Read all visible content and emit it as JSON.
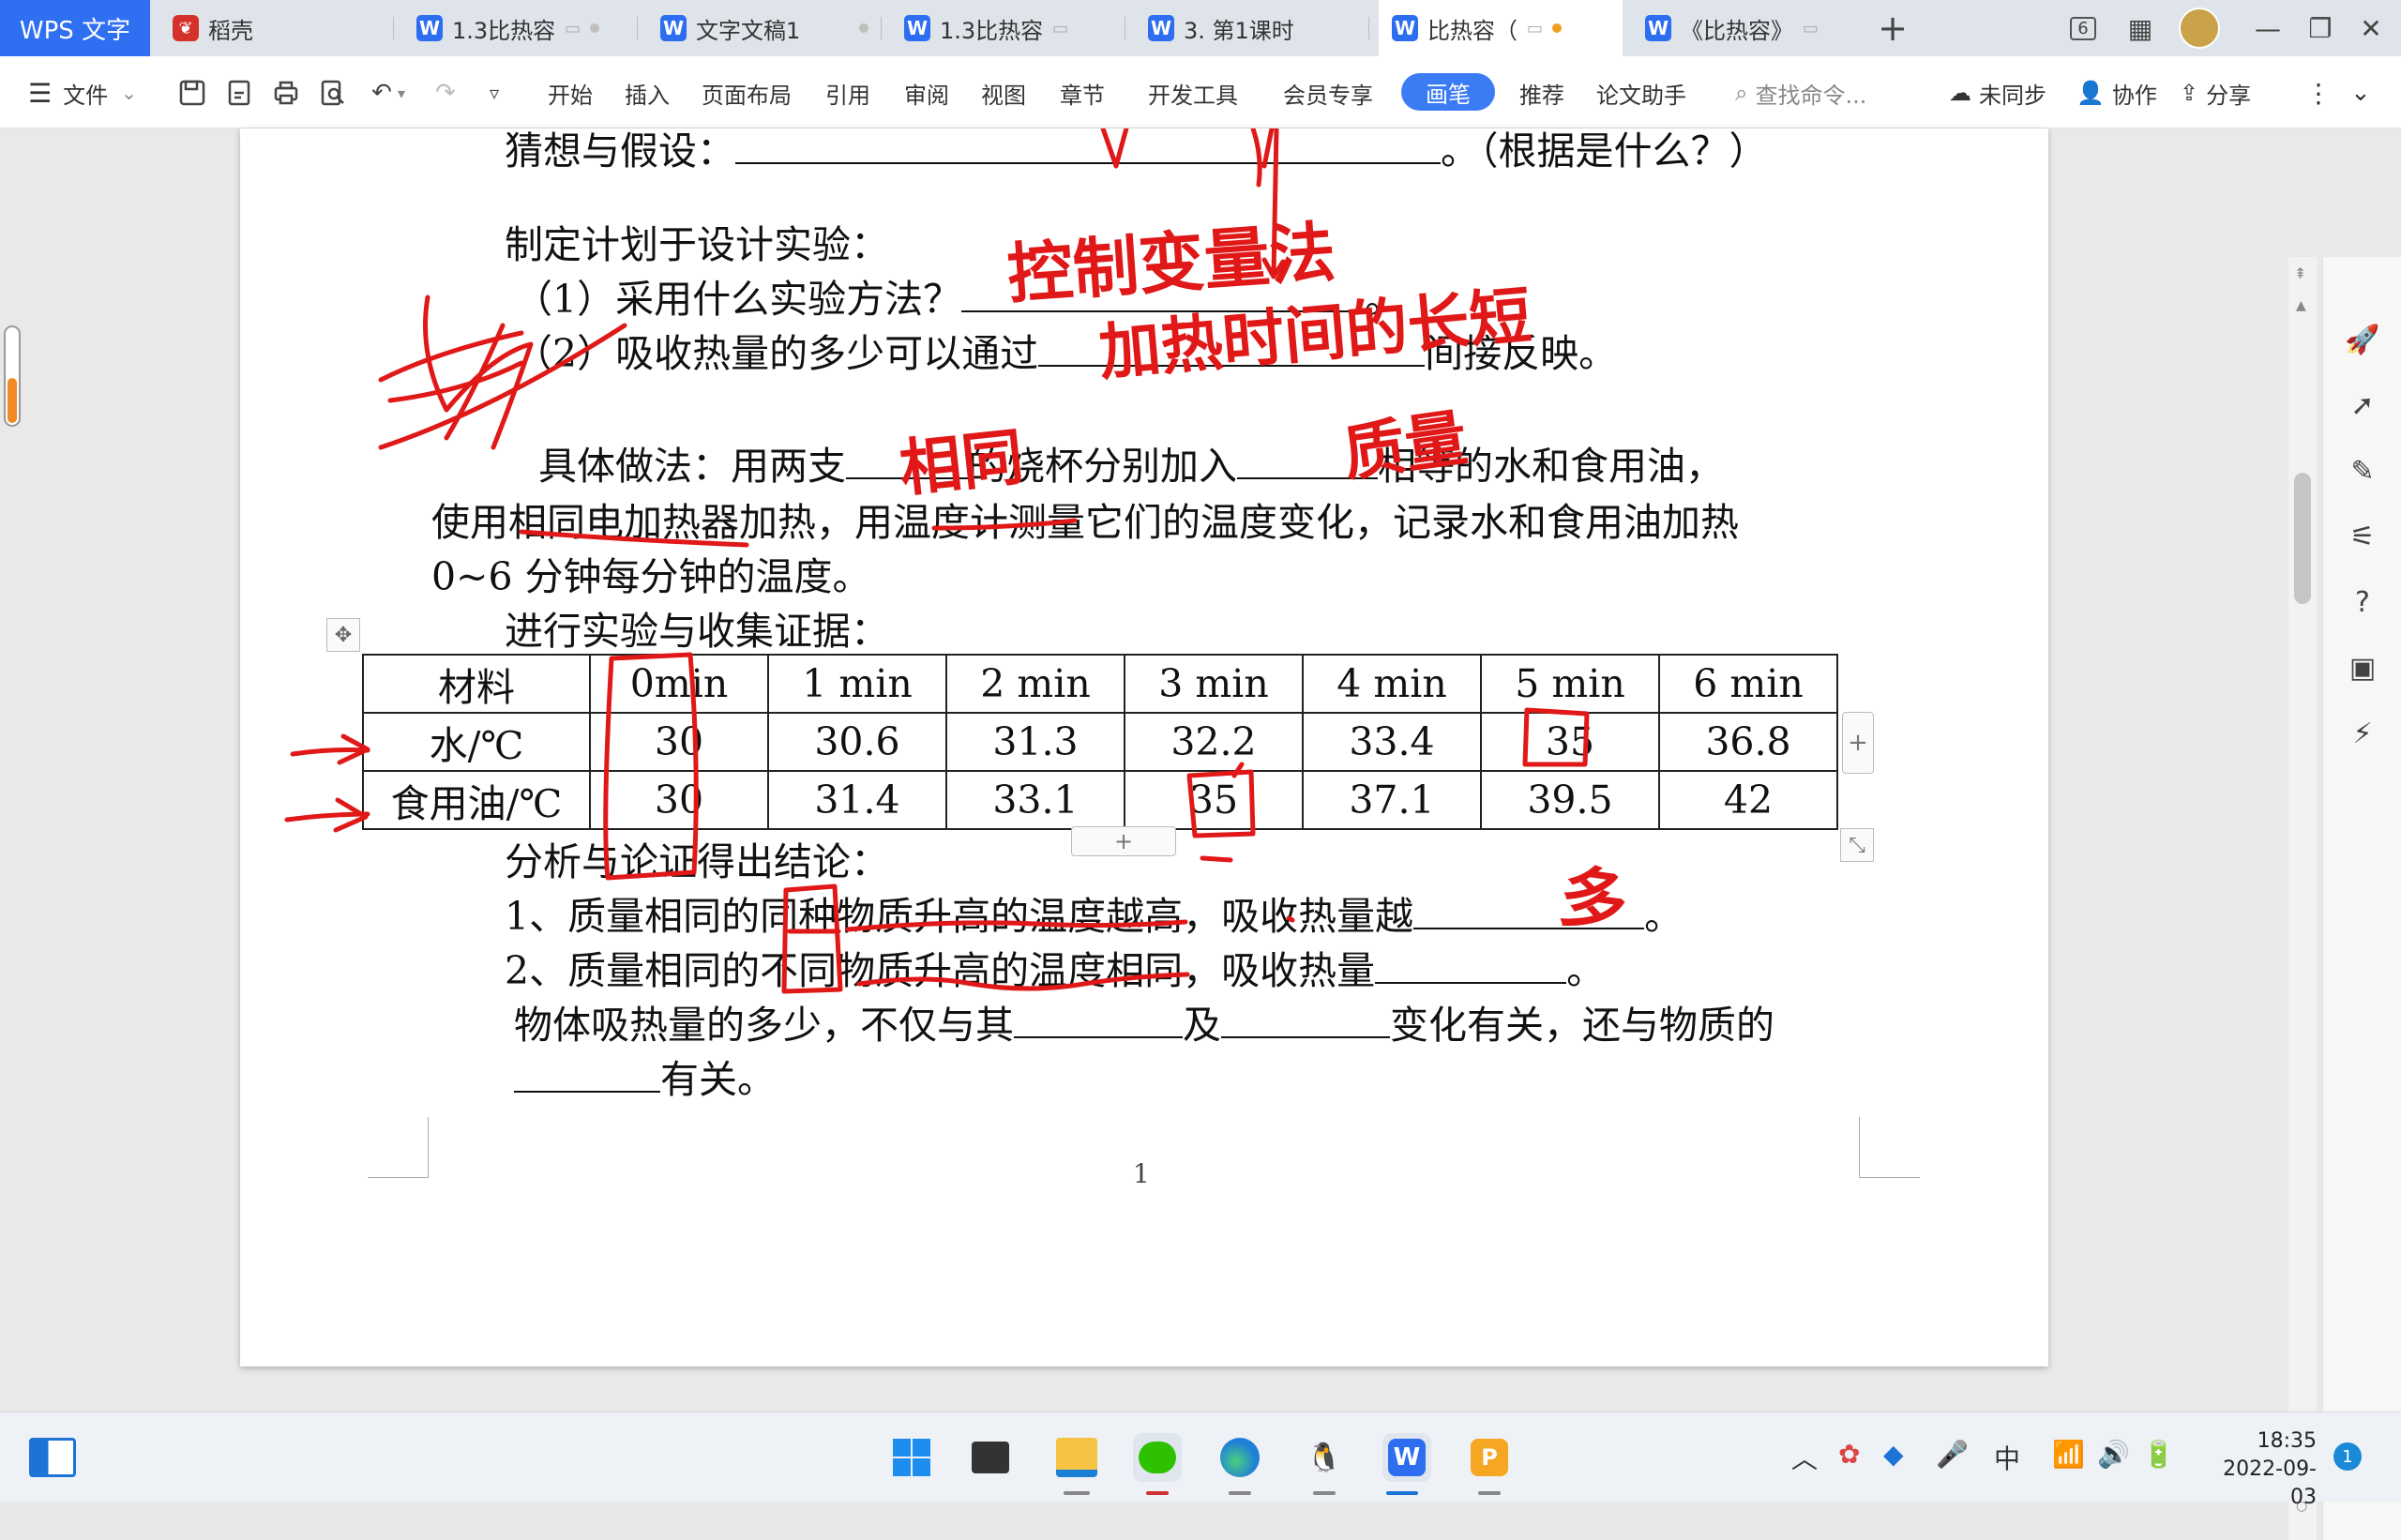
{
  "tabs": {
    "brand": "WPS 文字",
    "items": [
      {
        "label": "稻壳",
        "icon": "daoke-icon"
      },
      {
        "label": "1.3比热容",
        "icon": "wps-writer-icon"
      },
      {
        "label": "文字文稿1",
        "icon": "wps-writer-icon"
      },
      {
        "label": "1.3比热容",
        "icon": "wps-writer-icon"
      },
      {
        "label": "3. 第1课时",
        "icon": "wps-writer-icon"
      },
      {
        "label": "比热容（",
        "icon": "wps-writer-icon"
      },
      {
        "label": "《比热容》",
        "icon": "wps-writer-icon"
      }
    ],
    "new_tab": "+",
    "window_badge": "6"
  },
  "menu": {
    "file": "文件",
    "items": [
      "开始",
      "插入",
      "页面布局",
      "引用",
      "审阅",
      "视图",
      "章节",
      "开发工具",
      "会员专享"
    ],
    "pen": "画笔",
    "recommend": "推荐",
    "thesis": "论文助手",
    "search_placeholder": "查找命令...",
    "unsynced": "未同步",
    "collaborate": "协作",
    "share": "分享"
  },
  "doc": {
    "line_hyp": "猜想与假设：",
    "line_hyp_end": "。（根据是什么？）",
    "plan_title": "制定计划于设计实验：",
    "q1": "（1）采用什么实验方法？",
    "q1_end": "。",
    "q2": "（2）吸收热量的多少可以通过",
    "q2_end": "间接反映。",
    "method_a": "具体做法：用两支",
    "method_b": "的烧杯分别加入",
    "method_c": "相等的水和食用油，",
    "method_line2": "使用相同电加热器加热，用温度计测量它们的温度变化，记录水和食用油加热",
    "method_line3": "0~6 分钟每分钟的温度。",
    "collect": "进行实验与收集证据：",
    "table": {
      "headers": [
        "材料",
        "0min",
        "1 min",
        "2 min",
        "3 min",
        "4 min",
        "5 min",
        "6 min"
      ],
      "rows": [
        [
          "水/℃",
          "30",
          "30.6",
          "31.3",
          "32.2",
          "33.4",
          "35",
          "36.8"
        ],
        [
          "食用油/℃",
          "30",
          "31.4",
          "33.1",
          "35",
          "37.1",
          "39.5",
          "42"
        ]
      ]
    },
    "conclusion_title": "分析与论证得出结论：",
    "c1": "1、质量相同的同种物质升高的温度越高，吸收热量越",
    "c1_end": "。",
    "c2": "2、质量相同的不同物质升高的温度相同，吸收热量",
    "c2_end": "。",
    "c3a": "物体吸热量的多少，不仅与其",
    "c3b": "及",
    "c3c": "变化有关，还与物质的",
    "c4": "有关。",
    "page_number": "1"
  },
  "annotations": {
    "handwriting": [
      "控制变量法",
      "加热时间的长短",
      "相同",
      "质量",
      "多"
    ],
    "color": "#e01818"
  },
  "taskbar": {
    "ime": "中",
    "time": "18:35",
    "date": "2022-09-03",
    "notify_count": "1"
  }
}
